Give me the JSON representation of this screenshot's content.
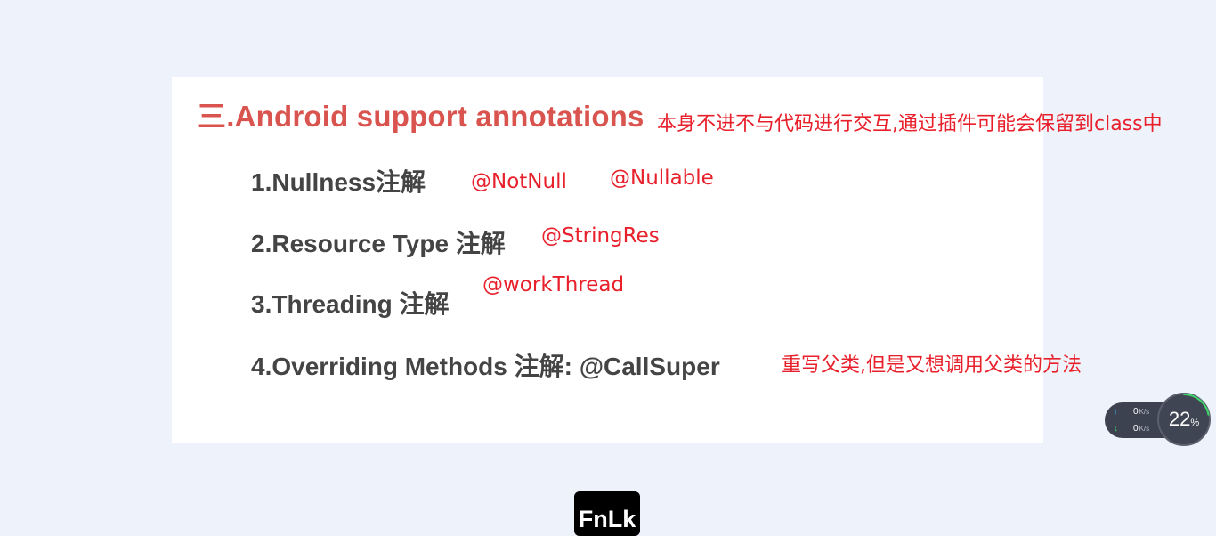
{
  "slide": {
    "title": "三.Android support annotations",
    "items": [
      "1.Nullness注解",
      "2.Resource Type 注解",
      "3.Threading 注解",
      "4.Overriding Methods 注解: @CallSuper"
    ]
  },
  "notes": {
    "title_note": "本身不进不与代码进行交互,通过插件可能会保留到class中",
    "not_null": "@NotNull",
    "nullable": "@Nullable",
    "string_res": "@StringRes",
    "work_thread": "@workThread",
    "call_super_note": "重写父类,但是又想调用父类的方法"
  },
  "net_monitor": {
    "upload_value": "0",
    "upload_unit": "K/s",
    "download_value": "0",
    "download_unit": "K/s",
    "usage_value": "22",
    "usage_unit": "%",
    "usage_fraction": 0.22
  },
  "key_overlay": {
    "label": "FnLk"
  },
  "colors": {
    "title": "#d9534f",
    "annotation": "#e8202b",
    "item_text": "#444444",
    "upload_arrow": "#3fb6ff",
    "download_arrow": "#3fd46b"
  }
}
